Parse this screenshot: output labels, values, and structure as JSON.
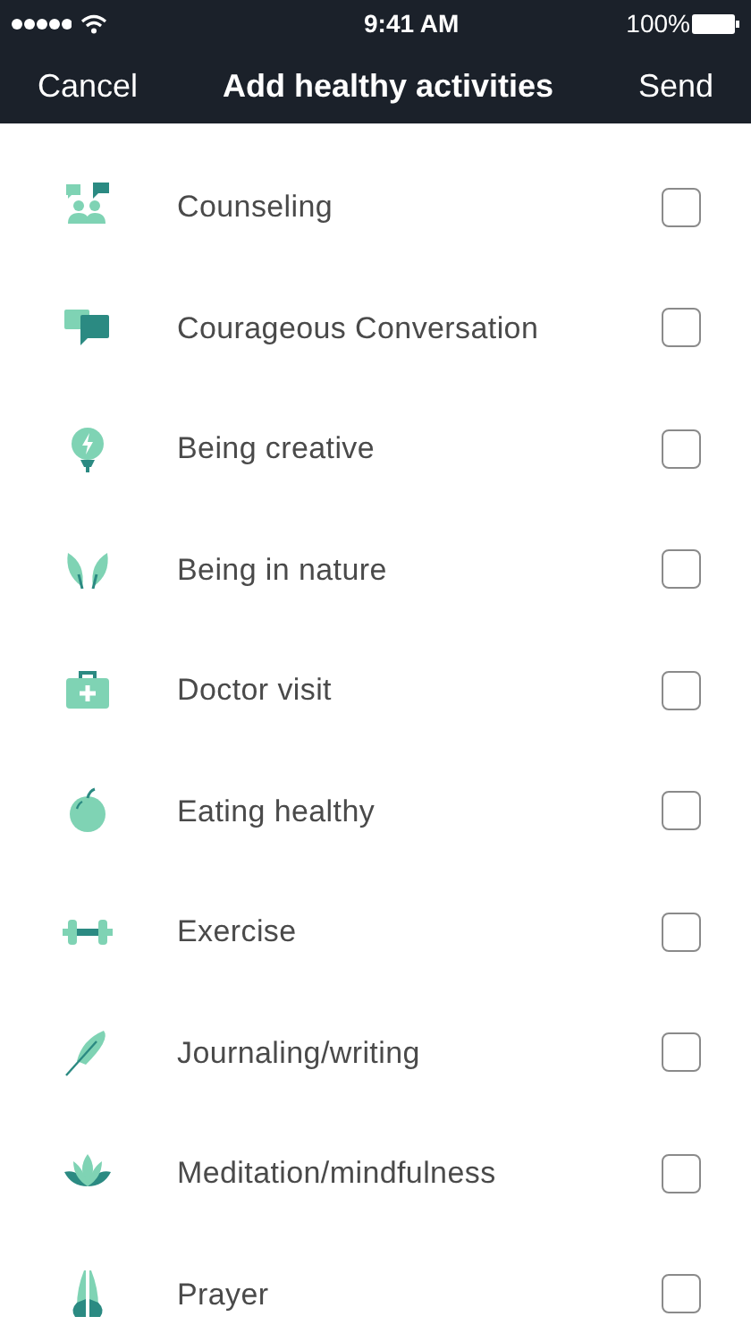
{
  "status_bar": {
    "time": "9:41 AM",
    "battery": "100%"
  },
  "nav": {
    "cancel": "Cancel",
    "title": "Add healthy activities",
    "send": "Send"
  },
  "activities": [
    {
      "label": "Counseling",
      "checked": false
    },
    {
      "label": "Courageous Conversation",
      "checked": false
    },
    {
      "label": "Being creative",
      "checked": false
    },
    {
      "label": "Being in nature",
      "checked": false
    },
    {
      "label": "Doctor visit",
      "checked": false
    },
    {
      "label": "Eating healthy",
      "checked": false
    },
    {
      "label": "Exercise",
      "checked": false
    },
    {
      "label": "Journaling/writing",
      "checked": false
    },
    {
      "label": "Meditation/mindfulness",
      "checked": false
    },
    {
      "label": "Prayer",
      "checked": false
    }
  ]
}
